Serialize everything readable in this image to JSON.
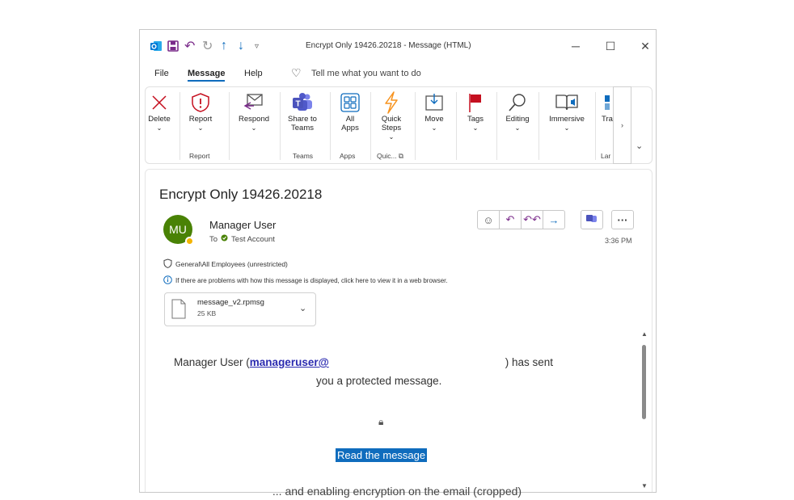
{
  "window": {
    "title": "Encrypt Only 19426.20218  -  Message (HTML)",
    "controls": [
      "minimize-icon",
      "maximize-icon",
      "close-icon"
    ]
  },
  "menubar": {
    "items": [
      "File",
      "Message",
      "Help"
    ],
    "active": "Message",
    "search_placeholder": "Tell me what you want to do"
  },
  "ribbon": {
    "buttons": [
      {
        "label": "Delete",
        "icon": "delete-icon"
      },
      {
        "label": "Report",
        "icon": "report-icon"
      },
      {
        "label": "Respond",
        "icon": "respond-icon"
      },
      {
        "label": "Share to Teams",
        "icon": "teams-icon"
      },
      {
        "label": "All Apps",
        "icon": "apps-icon"
      },
      {
        "label": "Quick Steps",
        "icon": "quick-steps-icon"
      },
      {
        "label": "Move",
        "icon": "move-icon"
      },
      {
        "label": "Tags",
        "icon": "tags-icon"
      },
      {
        "label": "Editing",
        "icon": "editing-icon"
      },
      {
        "label": "Immersive",
        "icon": "immersive-icon"
      },
      {
        "label": "Tra",
        "icon": "translate-icon"
      }
    ],
    "groups": [
      "Report",
      "Teams",
      "Apps",
      "Quic...",
      "Lar"
    ]
  },
  "message": {
    "subject": "Encrypt Only 19426.20218",
    "avatar_initials": "MU",
    "sender": "Manager User",
    "to_label": "To",
    "recipient": "Test Account",
    "time": "3:36 PM",
    "sensitivity": "General\\All Employees (unrestricted)",
    "info_bar": "If there are problems with how this message is displayed, click here to view it in a web browser.",
    "attachment": {
      "name": "message_v2.rpmsg",
      "size": "25 KB"
    },
    "body_prefix": "Manager User (",
    "body_link": "manageruser@",
    "body_suffix": ") has sent",
    "body_line2": "you a protected message.",
    "read_button": "Read the message"
  },
  "colors": {
    "accent": "#0f6cbd",
    "avatar": "#498205",
    "flag": "#c50f1f",
    "outlook": "#0078d4"
  },
  "caption": "... and enabling encryption on the email (cropped)"
}
